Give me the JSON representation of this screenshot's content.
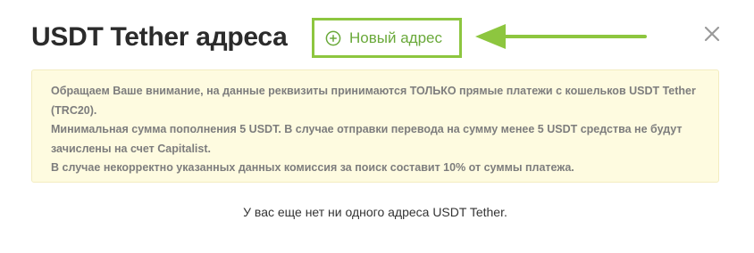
{
  "header": {
    "title": "USDT Tether адреса",
    "new_address_button": "Новый адрес"
  },
  "icons": {
    "plus": "plus-circle-icon",
    "close": "close-icon",
    "arrow": "arrow-left-icon"
  },
  "colors": {
    "accent_green": "#8dc63f",
    "notice_bg": "#fefbe0",
    "notice_text": "#7d7d7d"
  },
  "notice": {
    "lines": [
      "Обращаем Ваше внимание, на данные реквизиты принимаются ТОЛЬКО прямые платежи с кошельков USDT Tether (TRC20).",
      "Минимальная сумма пополнения 5 USDT. В случае отправки перевода на сумму менее 5 USDT средства не будут зачислены на счет Capitalist.",
      "В случае некорректно указанных данных комиссия за поиск составит 10% от суммы платежа."
    ]
  },
  "empty_state": "У вас еще нет ни одного адреса USDT Tether."
}
